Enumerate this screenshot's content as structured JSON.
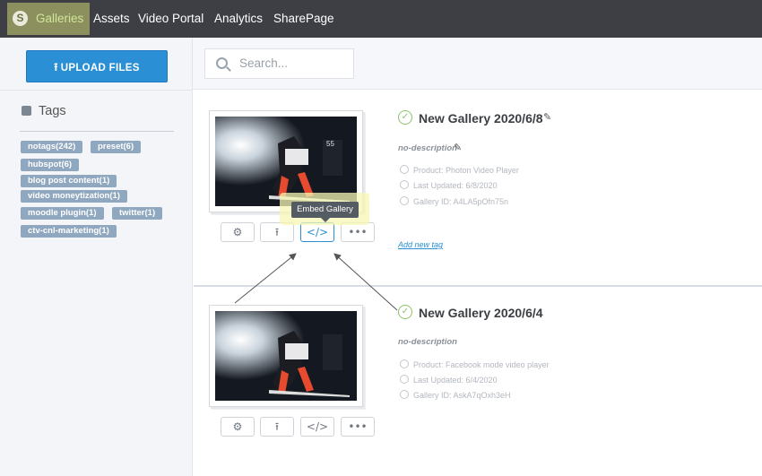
{
  "nav": {
    "items": [
      {
        "label": "Galleries",
        "active": true
      },
      {
        "label": "Assets"
      },
      {
        "label": "Video Portal"
      },
      {
        "label": "Analytics"
      },
      {
        "label": "SharePage"
      }
    ]
  },
  "sidebar": {
    "upload_label": "UPLOAD FILES",
    "tags_heading": "Tags",
    "tags": [
      "notags(242)",
      "preset(6)",
      "hubspot(6)",
      "blog post content(1)",
      "video moneytization(1)",
      "moodle plugin(1)",
      "twitter(1)",
      "ctv-cnl-marketing(1)"
    ]
  },
  "search": {
    "placeholder": "Search..."
  },
  "tooltip": {
    "text": "Embed Gallery"
  },
  "galleries": [
    {
      "title": "New Gallery 2020/6/8",
      "description": "no-description",
      "product": "Product: Photon Video Player",
      "updated": "Last Updated: 6/8/2020",
      "gallery_id": "Gallery ID: A4LA5pOfn75n",
      "add_tag": "Add new tag"
    },
    {
      "title": "New Gallery 2020/6/4",
      "description": "no-description",
      "product": "Product: Facebook mode video player",
      "updated": "Last Updated: 6/4/2020",
      "gallery_id": "Gallery ID: AskA7qOxh3eH"
    }
  ],
  "icons": {
    "logo": "logo-icon",
    "upload": "upload-arrow-icon",
    "tags": "tag-icon",
    "search": "search-icon",
    "check": "check-circle-icon",
    "edit": "pencil-icon",
    "settings": "gear-icon",
    "publish": "upload-icon",
    "embed": "code-icon",
    "more": "ellipsis-icon"
  },
  "colors": {
    "nav_bg": "#3d3f45",
    "nav_active": "#8c8f5e",
    "primary": "#2a8fd4",
    "tag_bg": "#8fa7bf",
    "success": "#8cc06a"
  }
}
